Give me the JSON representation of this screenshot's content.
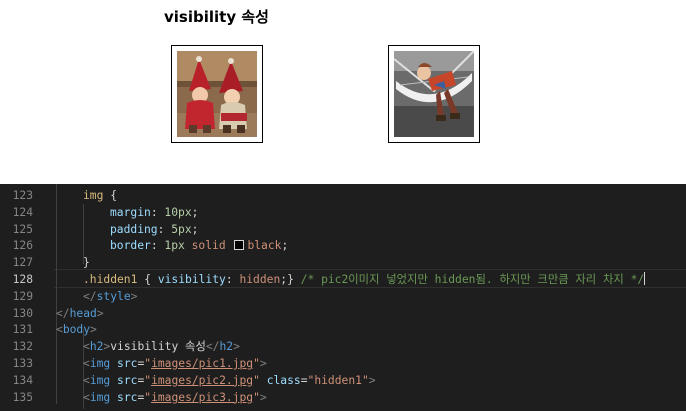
{
  "preview": {
    "heading": "visibility 속성",
    "images": [
      {
        "name": "pic1",
        "alt": "dolls"
      },
      {
        "name": "pic3",
        "alt": "hammock doll"
      }
    ]
  },
  "editor": {
    "lines": [
      {
        "num": "123",
        "tokens": [
          {
            "t": "sel",
            "v": "img"
          },
          {
            "t": "punc",
            "v": " {"
          }
        ]
      },
      {
        "num": "124",
        "tokens": [
          {
            "t": "prop",
            "v": "margin"
          },
          {
            "t": "punc",
            "v": ": "
          },
          {
            "t": "num",
            "v": "10px"
          },
          {
            "t": "punc",
            "v": ";"
          }
        ]
      },
      {
        "num": "125",
        "tokens": [
          {
            "t": "prop",
            "v": "padding"
          },
          {
            "t": "punc",
            "v": ": "
          },
          {
            "t": "num",
            "v": "5px"
          },
          {
            "t": "punc",
            "v": ";"
          }
        ]
      },
      {
        "num": "126",
        "tokens": [
          {
            "t": "prop",
            "v": "border"
          },
          {
            "t": "punc",
            "v": ": "
          },
          {
            "t": "num",
            "v": "1px"
          },
          {
            "t": "val",
            "v": " solid "
          },
          {
            "t": "swatch",
            "v": ""
          },
          {
            "t": "val",
            "v": "black"
          },
          {
            "t": "punc",
            "v": ";"
          }
        ]
      },
      {
        "num": "127",
        "tokens": [
          {
            "t": "punc",
            "v": "}"
          }
        ]
      },
      {
        "num": "128",
        "tokens": [
          {
            "t": "sel",
            "v": ".hidden1"
          },
          {
            "t": "punc",
            "v": " { "
          },
          {
            "t": "prop",
            "v": "visibility"
          },
          {
            "t": "punc",
            "v": ": "
          },
          {
            "t": "val",
            "v": "hidden"
          },
          {
            "t": "punc",
            "v": ";} "
          },
          {
            "t": "com",
            "v": "/* pic2이미지 넣었지만 hidden됨. 하지만 크만큼 자리 차지 */"
          }
        ]
      },
      {
        "num": "129",
        "tokens": [
          {
            "t": "brk",
            "v": "</"
          },
          {
            "t": "tag",
            "v": "style"
          },
          {
            "t": "brk",
            "v": ">"
          }
        ]
      },
      {
        "num": "130",
        "tokens": [
          {
            "t": "brk",
            "v": "</"
          },
          {
            "t": "tag",
            "v": "head"
          },
          {
            "t": "brk",
            "v": ">"
          }
        ]
      },
      {
        "num": "131",
        "tokens": [
          {
            "t": "brk",
            "v": "<"
          },
          {
            "t": "tag",
            "v": "body"
          },
          {
            "t": "brk",
            "v": ">"
          }
        ]
      },
      {
        "num": "132",
        "tokens": [
          {
            "t": "brk",
            "v": "<"
          },
          {
            "t": "tag",
            "v": "h2"
          },
          {
            "t": "brk",
            "v": ">"
          },
          {
            "t": "text",
            "v": "visibility 속성"
          },
          {
            "t": "brk",
            "v": "</"
          },
          {
            "t": "tag",
            "v": "h2"
          },
          {
            "t": "brk",
            "v": ">"
          }
        ]
      },
      {
        "num": "133",
        "tokens": [
          {
            "t": "brk",
            "v": "<"
          },
          {
            "t": "tag",
            "v": "img"
          },
          {
            "t": "attr",
            "v": " src"
          },
          {
            "t": "punc",
            "v": "="
          },
          {
            "t": "str",
            "v": "\""
          },
          {
            "t": "link",
            "v": "images/pic1.jpg"
          },
          {
            "t": "str",
            "v": "\""
          },
          {
            "t": "brk",
            "v": ">"
          }
        ]
      },
      {
        "num": "134",
        "tokens": [
          {
            "t": "brk",
            "v": "<"
          },
          {
            "t": "tag",
            "v": "img"
          },
          {
            "t": "attr",
            "v": " src"
          },
          {
            "t": "punc",
            "v": "="
          },
          {
            "t": "str",
            "v": "\""
          },
          {
            "t": "link",
            "v": "images/pic2.jpg"
          },
          {
            "t": "str",
            "v": "\""
          },
          {
            "t": "attr",
            "v": " class"
          },
          {
            "t": "punc",
            "v": "="
          },
          {
            "t": "str",
            "v": "\"hidden1\""
          },
          {
            "t": "brk",
            "v": ">"
          }
        ]
      },
      {
        "num": "135",
        "tokens": [
          {
            "t": "brk",
            "v": "<"
          },
          {
            "t": "tag",
            "v": "img"
          },
          {
            "t": "attr",
            "v": " src"
          },
          {
            "t": "punc",
            "v": "="
          },
          {
            "t": "str",
            "v": "\""
          },
          {
            "t": "link",
            "v": "images/pic3.jpg"
          },
          {
            "t": "str",
            "v": "\""
          },
          {
            "t": "brk",
            "v": ">"
          }
        ]
      }
    ]
  }
}
